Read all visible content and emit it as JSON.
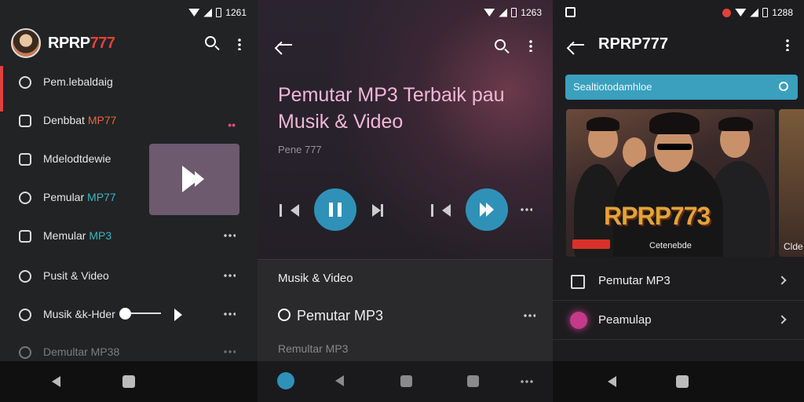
{
  "panel1": {
    "status": {
      "time": "1261"
    },
    "brand": {
      "part1": "RPRP",
      "part2": "777"
    },
    "menu": [
      {
        "label": "Pem.lebaldaig",
        "accent": ""
      },
      {
        "label": "Denbbat ",
        "accent": "MP77"
      },
      {
        "label": "Mdelodtdewie",
        "accent": ""
      },
      {
        "label": "Pemular ",
        "accent": "MP77"
      },
      {
        "label": "Memular ",
        "accent": "MP3"
      },
      {
        "label": "Pusit & Video",
        "accent": ""
      },
      {
        "label": "Musik &k-Hder",
        "accent": ""
      },
      {
        "label": "Demultar MP38",
        "accent": ""
      }
    ]
  },
  "panel2": {
    "status": {
      "time": "1263"
    },
    "title": "Pemutar MP3 Terbaik pau Musik & Video",
    "subtitle": "Pene 777",
    "rows": [
      {
        "label": "Musik & Video"
      },
      {
        "label": "Pemutar MP3"
      },
      {
        "label": "Remultar MP3"
      }
    ]
  },
  "panel3": {
    "status": {
      "time": "1288"
    },
    "title": "RPRP777",
    "search": {
      "placeholder": "Sealtiotodamhloe"
    },
    "card": {
      "logo": "RPRP773",
      "caption": "Cetenebde",
      "side_caption": "Clde"
    },
    "rows": [
      {
        "label": "Pemutar MP3"
      },
      {
        "label": "Peamulap"
      }
    ]
  },
  "colors": {
    "brand_red": "#e2413a",
    "accent_blue": "#2f91b8",
    "teal": "#3ab4c8",
    "pink_title": "#f0b8d6"
  }
}
